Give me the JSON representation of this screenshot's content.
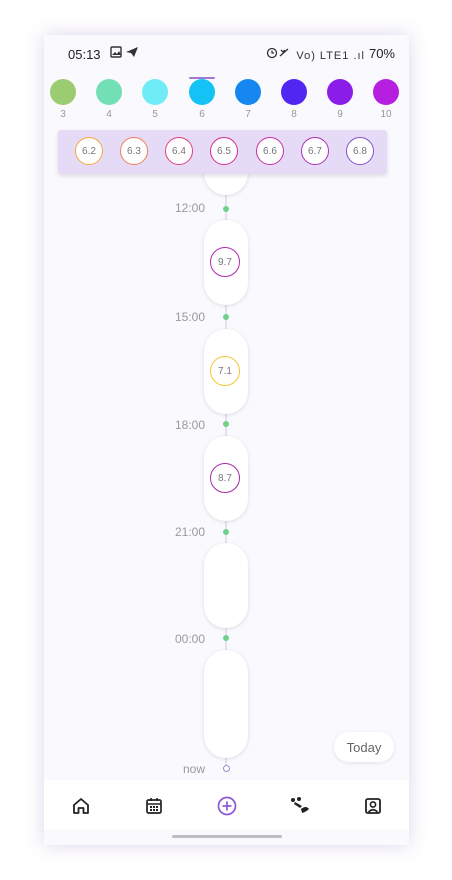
{
  "status_bar": {
    "time": "05:13",
    "right_text": "Vo) LTE1 .ıl",
    "battery": "70%"
  },
  "colors": [
    {
      "num": "3",
      "color": "#9ccc72"
    },
    {
      "num": "4",
      "color": "#72e0b4"
    },
    {
      "num": "5",
      "color": "#6fecf6"
    },
    {
      "num": "6",
      "color": "#15c2f5",
      "selected": true
    },
    {
      "num": "7",
      "color": "#1687f0"
    },
    {
      "num": "8",
      "color": "#5226f2"
    },
    {
      "num": "9",
      "color": "#8a1ee8"
    },
    {
      "num": "10",
      "color": "#b61ee0"
    }
  ],
  "popup": {
    "values": [
      {
        "label": "6.2",
        "color": "#f5a742"
      },
      {
        "label": "6.3",
        "color": "#ef7e5f"
      },
      {
        "label": "6.4",
        "color": "#e33e7d"
      },
      {
        "label": "6.5",
        "color": "#d22c8d"
      },
      {
        "label": "6.6",
        "color": "#ca2e9f"
      },
      {
        "label": "6.7",
        "color": "#b22fb6"
      },
      {
        "label": "6.8",
        "color": "#8d4fc6"
      }
    ]
  },
  "timeline": {
    "labels": [
      "12:00",
      "15:00",
      "18:00",
      "21:00",
      "00:00",
      "now"
    ],
    "readings": [
      {
        "label": "9.7",
        "color": "#b12aaf"
      },
      {
        "label": "7.1",
        "color": "#f2c434"
      },
      {
        "label": "8.7",
        "color": "#a62aa8"
      }
    ]
  },
  "today_button": "Today",
  "nav": {
    "home": "⌂",
    "calendar": "▦",
    "add": "⊕",
    "activity": "⚡",
    "profile": "▣"
  }
}
